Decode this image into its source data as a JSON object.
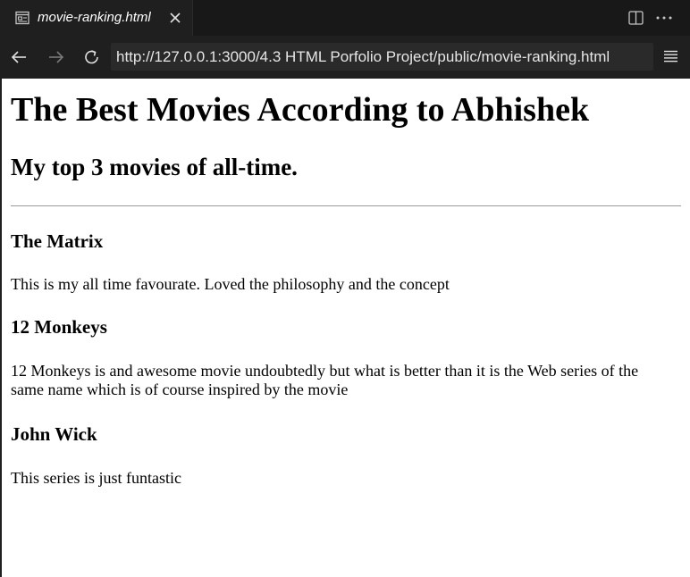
{
  "tab": {
    "title": "movie-ranking.html",
    "icon": "preview-icon"
  },
  "toolbar": {
    "url": "http://127.0.0.1:3000/4.3 HTML Porfolio Project/public/movie-ranking.html"
  },
  "page": {
    "heading": "The Best Movies According to Abhishek",
    "subheading": "My top 3 movies of all-time.",
    "movies": [
      {
        "title": "The Matrix",
        "description": "This is my all time favourate. Loved the philosophy and the concept"
      },
      {
        "title": "12 Monkeys",
        "description": "12 Monkeys is and awesome movie undoubtedly but what is better than it is the Web series of the same name which is of course inspired by the movie"
      },
      {
        "title": "John Wick",
        "description": "This series is just funtastic"
      }
    ]
  },
  "colors": {
    "chrome_dark": "#181818",
    "chrome": "#1f1f1f",
    "url_bg": "#2a2a2a",
    "text_light": "#e6e6e6"
  }
}
